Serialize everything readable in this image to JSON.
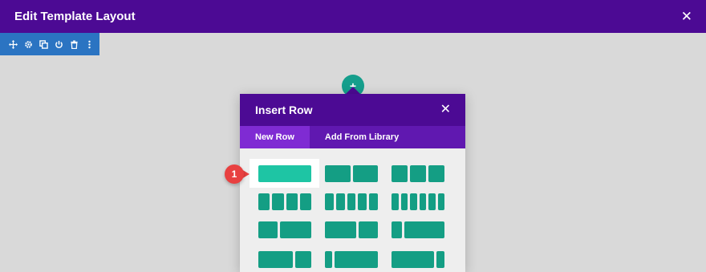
{
  "topbar": {
    "title": "Edit Template Layout",
    "close_glyph": "✕"
  },
  "section_toolbar": {
    "icons": [
      "move-icon",
      "gear-icon",
      "duplicate-icon",
      "power-icon",
      "trash-icon",
      "more-icon"
    ]
  },
  "add_button": {
    "glyph": "+"
  },
  "modal": {
    "title": "Insert Row",
    "close_glyph": "✕",
    "tabs": [
      {
        "label": "New Row",
        "active": true
      },
      {
        "label": "Add From Library",
        "active": false
      }
    ]
  },
  "callout": {
    "number": "1"
  },
  "colors": {
    "topbar": "#4c0a94",
    "toolbar": "#2b74c2",
    "layout_block": "#149e84",
    "layout_selected": "#1ec5a4",
    "badge": "#e84040"
  }
}
